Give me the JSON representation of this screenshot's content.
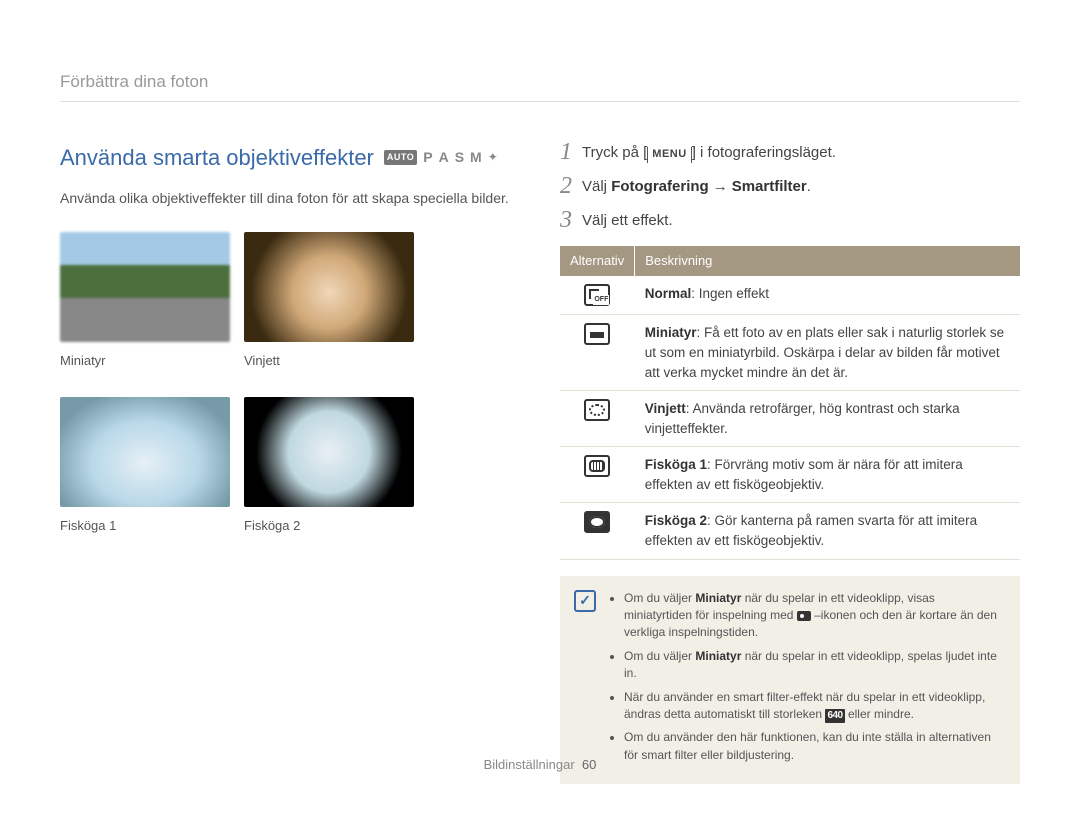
{
  "breadcrumb": "Förbättra dina foton",
  "title": "Använda smarta objektiveffekter",
  "mode_badge": "AUTO",
  "mode_letters": [
    "P",
    "A",
    "S",
    "M"
  ],
  "subtitle": "Använda olika objektiveffekter till dina foton för att skapa speciella bilder.",
  "thumbs": {
    "miniatyr": "Miniatyr",
    "vinjett": "Vinjett",
    "fiskoga1": "Fisköga 1",
    "fiskoga2": "Fisköga 2"
  },
  "steps": {
    "s1_a": "Tryck på [",
    "s1_key": "MENU",
    "s1_b": "] i fotograferingsläget.",
    "s2_a": "Välj ",
    "s2_b1": "Fotografering",
    "s2_arrow": "→",
    "s2_b2": "Smartfilter",
    "s2_c": ".",
    "s3": "Välj ett effekt."
  },
  "table": {
    "h1": "Alternativ",
    "h2": "Beskrivning",
    "r1_b": "Normal",
    "r1_t": ": Ingen effekt",
    "r2_b": "Miniatyr",
    "r2_t": ": Få ett foto av en plats eller sak i naturlig storlek se ut som en miniatyrbild. Oskärpa i delar av bilden får motivet att verka mycket mindre än det är.",
    "r3_b": "Vinjett",
    "r3_t": ": Använda retrofärger, hög kontrast och starka vinjetteffekter.",
    "r4_b": "Fisköga 1",
    "r4_t": ": Förvräng motiv som är nära för att imitera effekten av ett fiskögeobjektiv.",
    "r5_b": "Fisköga 2",
    "r5_t": ": Gör kanterna på ramen svarta för att imitera effekten av ett fiskögeobjektiv."
  },
  "notes": {
    "n1_a": "Om du väljer ",
    "n1_b": "Miniatyr",
    "n1_c": " när du spelar in ett videoklipp, visas miniatyrtiden för inspelning med ",
    "n1_d": " –ikonen och den är kortare än den verkliga inspelningstiden.",
    "n2_a": "Om du väljer ",
    "n2_b": "Miniatyr",
    "n2_c": " när du spelar in ett videoklipp, spelas ljudet inte in.",
    "n3_a": "När du använder en smart filter-effekt när du spelar in ett videoklipp, ändras detta automatiskt till storleken ",
    "n3_size": "640",
    "n3_b": " eller mindre.",
    "n4": "Om du använder den här funktionen, kan du inte ställa in alternativen för smart filter eller bildjustering."
  },
  "footer": {
    "section": "Bildinställningar",
    "page": "60"
  }
}
